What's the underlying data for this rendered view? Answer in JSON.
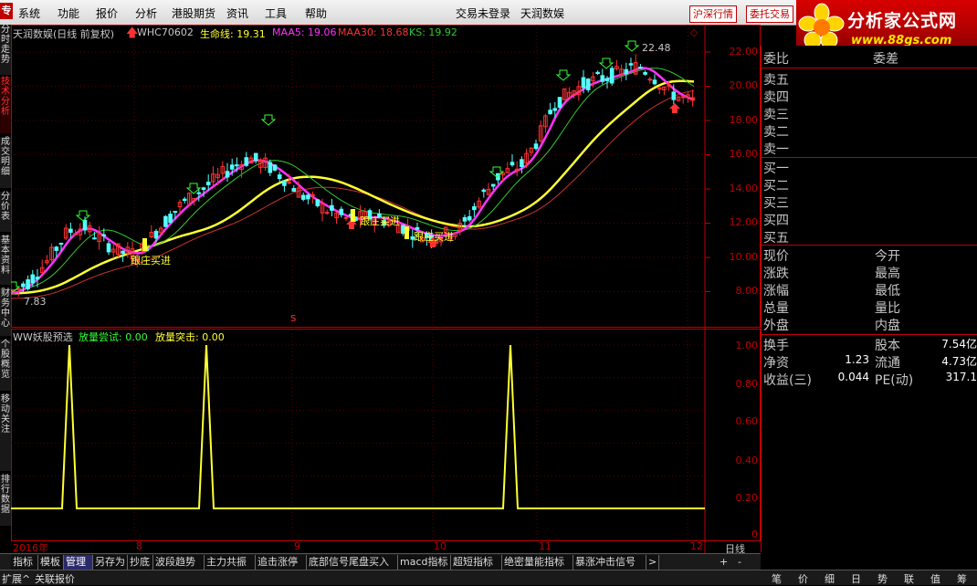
{
  "menu": {
    "logo": "专",
    "items": [
      "系统",
      "功能",
      "报价",
      "分析",
      "港股期货",
      "资讯",
      "工具",
      "帮助"
    ],
    "trade_status": "交易未登录",
    "app_name": "天润数娱",
    "btn_hushen": "沪深行情",
    "btn_weituo": "委托交易"
  },
  "brand": {
    "title": "分析家公式网",
    "url": "www.88gs.com"
  },
  "left_tabs": [
    "分时走势",
    "技术分析",
    "成交明细",
    "分价表",
    "基本资料",
    "财务中心",
    "个股概览",
    "移动关注",
    "排行数据"
  ],
  "main_chart": {
    "stock_title": "天润数娱(日线 前复权)",
    "code": "WHC70602",
    "life_label": "生命线: 19.31",
    "maa5": "MAA5: 19.06",
    "maa30": "MAA30: 18.68",
    "ks": "KS: 19.92",
    "peak_label": "22.48",
    "low_label": "7.83",
    "anno1": "跟庄买进",
    "anno2": "跟庄买进",
    "anno3": "跟庄买进",
    "s_marker": "S",
    "colors": {
      "up": "#ff3232",
      "down": "#54ffff",
      "life": "#ff32ff",
      "maa5": "#ffff32",
      "maa30": "#c83232",
      "ks": "#32c832"
    }
  },
  "price_axis": [
    "22.00",
    "20.00",
    "18.00",
    "16.00",
    "14.00",
    "12.00",
    "10.00",
    "8.00"
  ],
  "indicator": {
    "name": "WW妖股预选",
    "l1": "放量尝试: 0.00",
    "l2": "放量突击: 0.00",
    "axis": [
      "1.00",
      "0.80",
      "0.60",
      "0.40",
      "0.20",
      "0"
    ]
  },
  "date_axis": [
    "2016年",
    "8",
    "9",
    "10",
    "11",
    "12"
  ],
  "date_period": "日线",
  "quote_panel": {
    "weibi": "委比",
    "weicha": "委差",
    "sell": [
      "卖五",
      "卖四",
      "卖三",
      "卖二",
      "卖一"
    ],
    "buy": [
      "买一",
      "买二",
      "买三",
      "买四",
      "买五"
    ],
    "grid": [
      [
        "现价",
        "今开"
      ],
      [
        "涨跌",
        "最高"
      ],
      [
        "涨幅",
        "最低"
      ],
      [
        "总量",
        "量比"
      ],
      [
        "外盘",
        "内盘"
      ]
    ],
    "fin": [
      {
        "k1": "换手",
        "v1": "",
        "k2": "股本",
        "v2": "7.54亿"
      },
      {
        "k1": "净资",
        "v1": "1.23",
        "k2": "流通",
        "v2": "4.73亿"
      },
      {
        "k1": "收益(三)",
        "v1": "0.044",
        "k2": "PE(动)",
        "v2": "317.1"
      }
    ]
  },
  "bottom_tabs": [
    "指标",
    "模板",
    "管理",
    "另存为",
    "抄底",
    "波段趋势",
    "主力共振",
    "追击涨停",
    "底部信号尾盘买入",
    "macd指标",
    "超短指标",
    "绝密量能指标",
    "暴涨冲击信号",
    ">"
  ],
  "zoom_btns": [
    "+",
    "-"
  ],
  "status_tabs": [
    "扩展^",
    "关联报价"
  ],
  "right_tabs": [
    "笔",
    "价",
    "细",
    "日",
    "势",
    "联",
    "值",
    "筹"
  ]
}
